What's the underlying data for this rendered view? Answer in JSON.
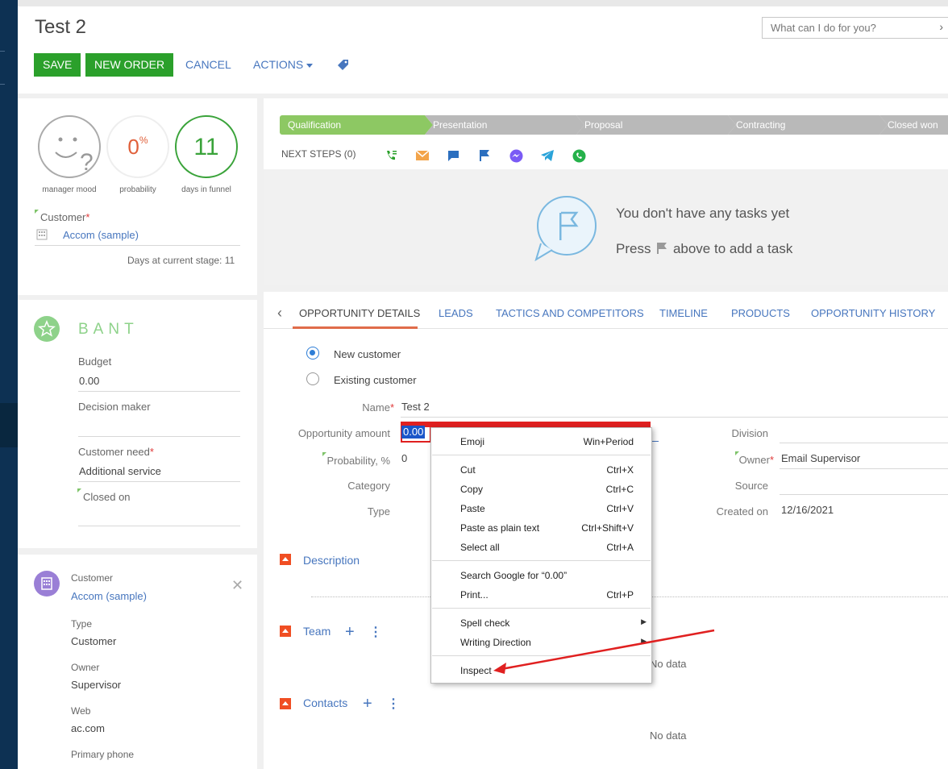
{
  "header": {
    "title": "Test 2",
    "search_placeholder": "What can I do for you?",
    "save_label": "SAVE",
    "new_order_label": "NEW ORDER",
    "cancel_label": "CANCEL",
    "actions_label": "ACTIONS"
  },
  "summary": {
    "manager_mood_label": "manager mood",
    "probability_value": "0",
    "probability_unit": "%",
    "probability_label": "probability",
    "days_value": "11",
    "days_label": "days in funnel",
    "customer_caption": "Customer",
    "customer_value": "Accom (sample)",
    "days_at_stage_label": "Days at current stage:",
    "days_at_stage_value": "11"
  },
  "stages": [
    "Qualification",
    "Presentation",
    "Proposal",
    "Contracting",
    "Closed won"
  ],
  "next_steps": {
    "label": "NEXT STEPS (0)",
    "empty_line1": "You don't have any tasks yet",
    "empty_line2_a": "Press",
    "empty_line2_b": "above to add a task"
  },
  "bant": {
    "title": "BANT",
    "budget_label": "Budget",
    "budget_value": "0.00",
    "decision_maker_label": "Decision maker",
    "decision_maker_value": "",
    "customer_need_label": "Customer need",
    "customer_need_value": "Additional service",
    "closed_on_label": "Closed on",
    "closed_on_value": ""
  },
  "customer_card": {
    "caption": "Customer",
    "name": "Accom (sample)",
    "type_label": "Type",
    "type_value": "Customer",
    "owner_label": "Owner",
    "owner_value": "Supervisor",
    "web_label": "Web",
    "web_value": "ac.com",
    "phone_label": "Primary phone"
  },
  "tabs": [
    "OPPORTUNITY DETAILS",
    "LEADS",
    "TACTICS AND COMPETITORS",
    "TIMELINE",
    "PRODUCTS",
    "OPPORTUNITY HISTORY"
  ],
  "details": {
    "new_customer_label": "New customer",
    "existing_customer_label": "Existing customer",
    "name_label": "Name",
    "name_value": "Test 2",
    "amount_label": "Opportunity amount",
    "amount_value": "0.00",
    "probability_label": "Probability, %",
    "probability_value": "0",
    "category_label": "Category",
    "type_label": "Type",
    "division_label": "Division",
    "owner_label": "Owner",
    "owner_value": "Email Supervisor",
    "source_label": "Source",
    "created_on_label": "Created on",
    "created_on_value": "12/16/2021"
  },
  "sections": {
    "description": "Description",
    "team": "Team",
    "team_empty": "No data",
    "contacts": "Contacts",
    "contacts_empty": "No data"
  },
  "context_menu": {
    "emoji": "Emoji",
    "emoji_sc": "Win+Period",
    "cut": "Cut",
    "cut_sc": "Ctrl+X",
    "copy": "Copy",
    "copy_sc": "Ctrl+C",
    "paste": "Paste",
    "paste_sc": "Ctrl+V",
    "paste_plain": "Paste as plain text",
    "paste_plain_sc": "Ctrl+Shift+V",
    "select_all": "Select all",
    "select_all_sc": "Ctrl+A",
    "search_google": "Search Google for “0.00”",
    "print": "Print...",
    "print_sc": "Ctrl+P",
    "spell_check": "Spell check",
    "writing_direction": "Writing Direction",
    "inspect": "Inspect"
  },
  "colors": {
    "accent_green": "#2ba02b",
    "link_blue": "#4776be",
    "annotation_red": "#e02020",
    "stage_active": "#8dc863",
    "section_orange": "#f04e23"
  }
}
